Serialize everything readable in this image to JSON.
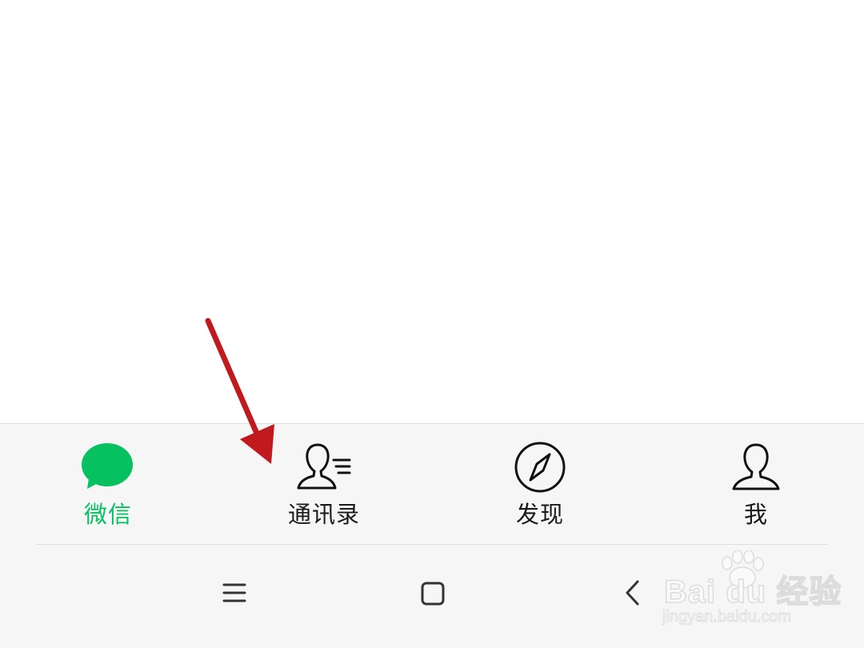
{
  "tabs": [
    {
      "label": "微信",
      "icon": "chat-bubble-icon",
      "active": true
    },
    {
      "label": "通讯录",
      "icon": "contacts-icon",
      "active": false
    },
    {
      "label": "发现",
      "icon": "compass-icon",
      "active": false
    },
    {
      "label": "我",
      "icon": "person-icon",
      "active": false
    }
  ],
  "colors": {
    "active": "#07c160",
    "inactive_text": "#1a1a1a",
    "tabbar_bg": "#f6f6f6",
    "annotation_arrow": "#c0191e"
  },
  "system_nav": {
    "menu": "menu-icon",
    "home": "home-icon",
    "back": "back-icon"
  },
  "watermark": {
    "brand": "Bai du 经验",
    "url": "jingyan.baidu.com"
  }
}
